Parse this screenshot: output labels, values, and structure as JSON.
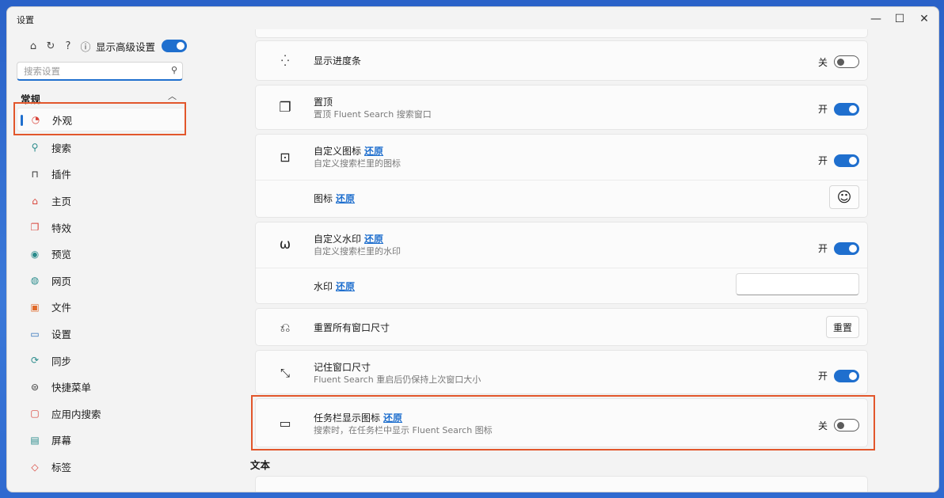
{
  "window": {
    "title": "设置"
  },
  "sidebar": {
    "show_advanced_label": "显示高级设置",
    "show_advanced_on": true,
    "search_placeholder": "搜索设置",
    "section": "常规",
    "items": [
      {
        "label": "外观",
        "icon": "palette-icon",
        "glyph": "◔",
        "active": true
      },
      {
        "label": "搜索",
        "icon": "search-icon",
        "glyph": "⚲"
      },
      {
        "label": "插件",
        "icon": "plugin-icon",
        "glyph": "⌂"
      },
      {
        "label": "主页",
        "icon": "home-icon",
        "glyph": "⌂"
      },
      {
        "label": "特效",
        "icon": "effects-icon",
        "glyph": "❐"
      },
      {
        "label": "预览",
        "icon": "eye-icon",
        "glyph": "◉"
      },
      {
        "label": "网页",
        "icon": "globe-icon",
        "glyph": "◍"
      },
      {
        "label": "文件",
        "icon": "file-icon",
        "glyph": "▣"
      },
      {
        "label": "设置",
        "icon": "laptop-icon",
        "glyph": "▭"
      },
      {
        "label": "同步",
        "icon": "sync-icon",
        "glyph": "⟳"
      },
      {
        "label": "快捷菜单",
        "icon": "menu-icon",
        "glyph": "≡"
      },
      {
        "label": "应用内搜索",
        "icon": "app-search-icon",
        "glyph": "▢"
      },
      {
        "label": "屏幕",
        "icon": "screen-icon",
        "glyph": "▤"
      },
      {
        "label": "标签",
        "icon": "tag-icon",
        "glyph": "◇"
      }
    ]
  },
  "settings": {
    "progress": {
      "title": "显示进度条",
      "state": "关"
    },
    "topmost": {
      "title": "置顶",
      "desc": "置顶 Fluent Search 搜索窗口",
      "state": "开"
    },
    "custom_icon": {
      "title": "自定义图标",
      "reset": "还原",
      "desc": "自定义搜索栏里的图标",
      "state": "开"
    },
    "icon": {
      "title": "图标",
      "reset": "还原",
      "value": "☺"
    },
    "custom_watermark": {
      "title": "自定义水印",
      "reset": "还原",
      "desc": "自定义搜索栏里的水印",
      "state": "开"
    },
    "watermark": {
      "title": "水印",
      "reset": "还原",
      "value": ""
    },
    "reset_windows": {
      "title": "重置所有窗口尺寸",
      "button": "重置"
    },
    "remember_size": {
      "title": "记住窗口尺寸",
      "desc": "Fluent Search 重启后仍保持上次窗口大小",
      "state": "开"
    },
    "taskbar_icon": {
      "title": "任务栏显示图标",
      "reset": "还原",
      "desc": "搜索时，在任务栏中显示 Fluent Search 图标",
      "state": "关"
    }
  },
  "section_text": "文本",
  "colors": {
    "accent": "#1f6fce",
    "highlight": "#e2562b"
  }
}
